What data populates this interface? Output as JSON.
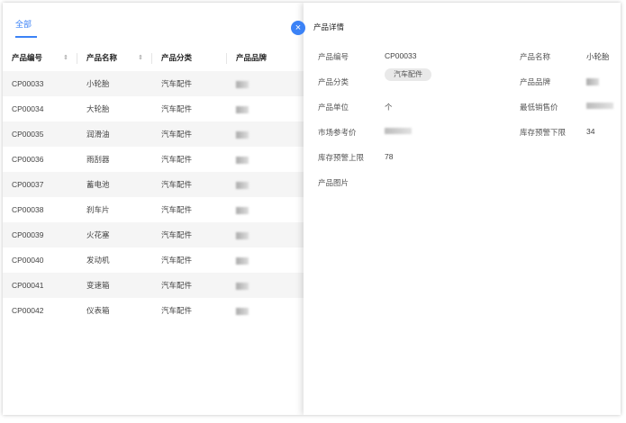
{
  "tabs": {
    "active": "全部"
  },
  "table": {
    "headers": [
      "产品编号",
      "产品名称",
      "产品分类",
      "产品品牌"
    ],
    "sort_glyph": "⇕",
    "rows": [
      {
        "code": "CP00033",
        "name": "小轮胎",
        "category": "汽车配件"
      },
      {
        "code": "CP00034",
        "name": "大轮胎",
        "category": "汽车配件"
      },
      {
        "code": "CP00035",
        "name": "润滑油",
        "category": "汽车配件"
      },
      {
        "code": "CP00036",
        "name": "雨刮器",
        "category": "汽车配件"
      },
      {
        "code": "CP00037",
        "name": "蓄电池",
        "category": "汽车配件"
      },
      {
        "code": "CP00038",
        "name": "刹车片",
        "category": "汽车配件"
      },
      {
        "code": "CP00039",
        "name": "火花塞",
        "category": "汽车配件"
      },
      {
        "code": "CP00040",
        "name": "发动机",
        "category": "汽车配件"
      },
      {
        "code": "CP00041",
        "name": "变速箱",
        "category": "汽车配件"
      },
      {
        "code": "CP00042",
        "name": "仪表箱",
        "category": "汽车配件"
      }
    ]
  },
  "drawer": {
    "title": "产品详情",
    "close_glyph": "×",
    "fields": {
      "code_label": "产品编号",
      "code_value": "CP00033",
      "name_label": "产品名称",
      "name_value": "小轮胎",
      "category_label": "产品分类",
      "category_value": "汽车配件",
      "brand_label": "产品品牌",
      "unit_label": "产品单位",
      "unit_value": "个",
      "min_price_label": "最低销售价",
      "market_price_label": "市场参考价",
      "stock_low_label": "库存预警下限",
      "stock_low_value": "34",
      "stock_high_label": "库存预警上限",
      "stock_high_value": "78",
      "image_label": "产品图片"
    }
  },
  "colors": {
    "accent": "#3b82f6",
    "stripe": "#f5f5f5"
  }
}
